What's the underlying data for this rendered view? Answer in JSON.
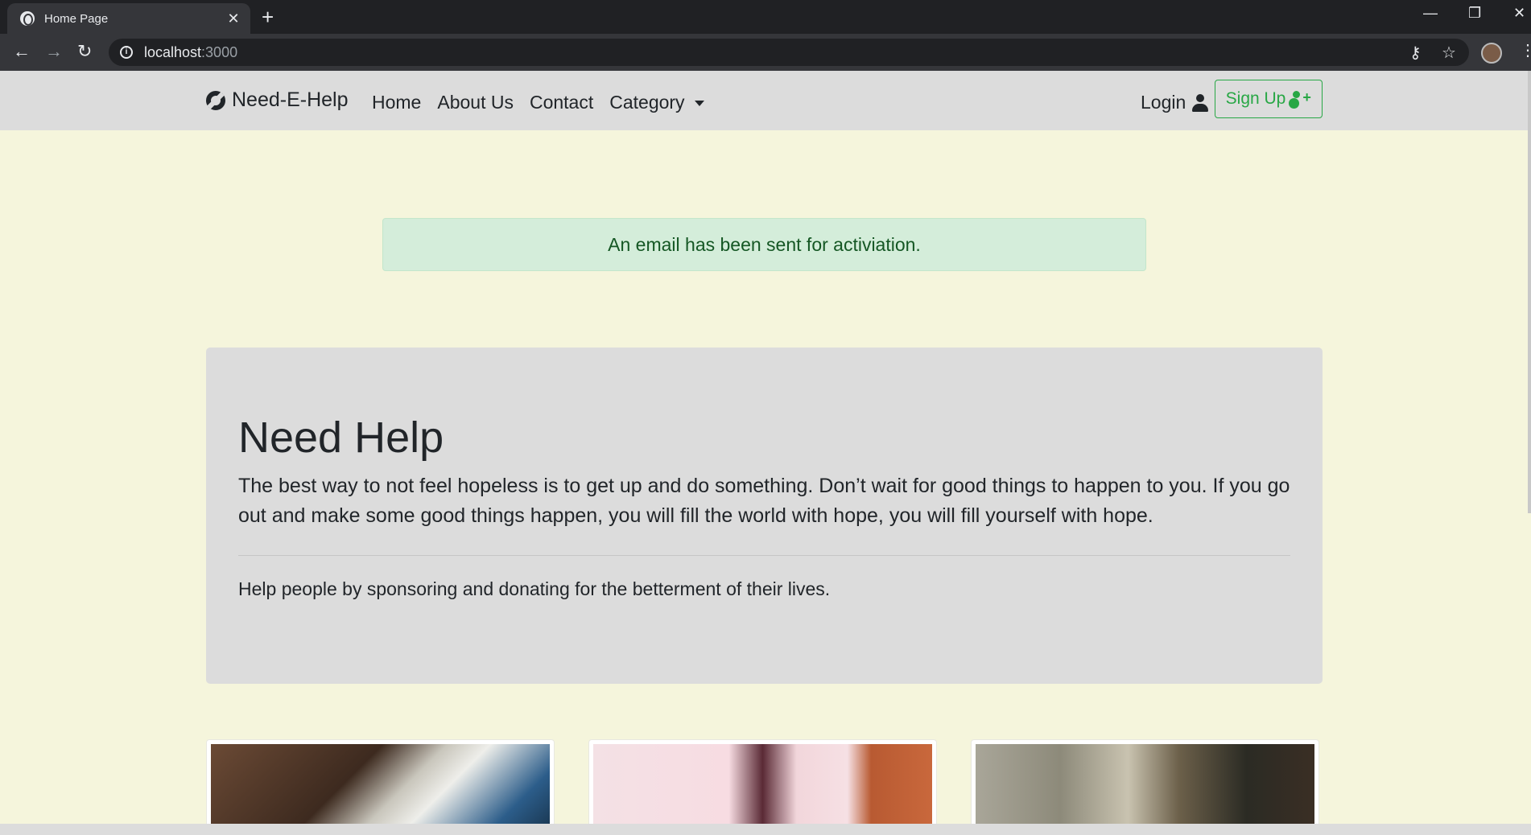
{
  "browser": {
    "tab_title": "Home Page",
    "new_tab": "+",
    "close_tab": "✕",
    "url_host": "localhost",
    "url_port": ":3000"
  },
  "navbar": {
    "brand": "Need-E-Help",
    "links": [
      "Home",
      "About Us",
      "Contact",
      "Category"
    ],
    "login": "Login",
    "signup": "Sign Up"
  },
  "alert": {
    "message": "An email has been sent for activiation."
  },
  "jumbotron": {
    "title": "Need Help",
    "lead": "The best way to not feel hopeless is to get up and do something. Don’t wait for good things to happen to you. If you go out and make some good things happen, you will fill the world with hope, you will fill yourself with hope.",
    "sub": "Help people by sponsoring and donating for the betterment of their lives."
  },
  "colors": {
    "page_bg": "#f5f5dc",
    "navbar_bg": "#dcdcdc",
    "accent_green": "#28a745",
    "alert_bg": "#d4edda"
  }
}
